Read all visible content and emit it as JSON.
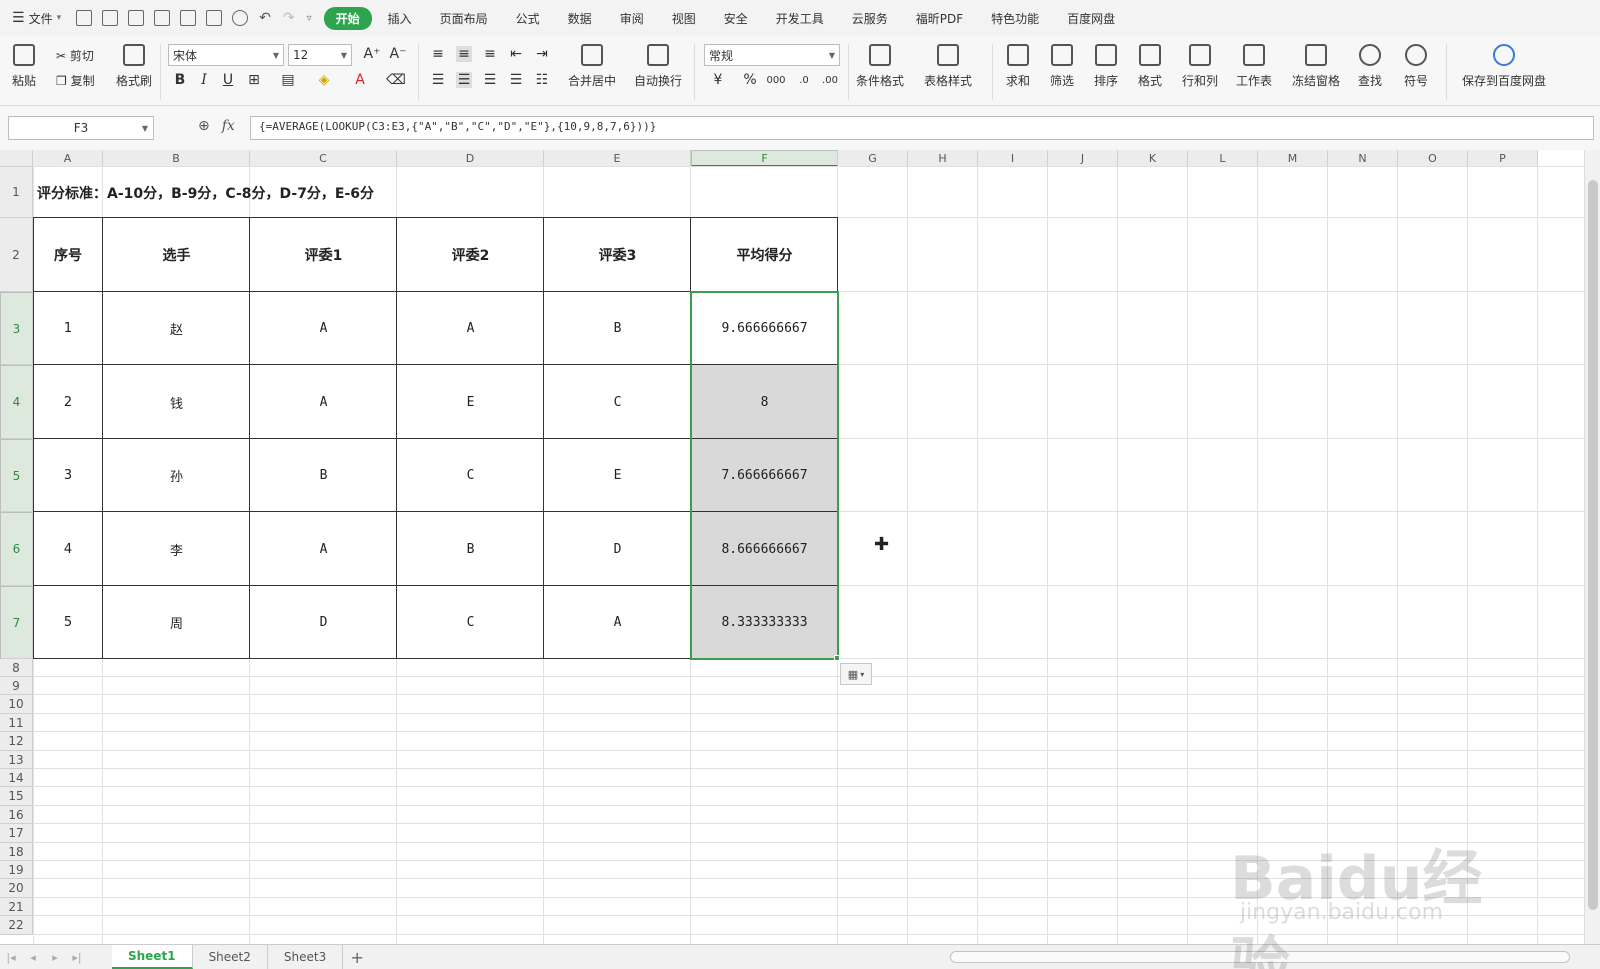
{
  "menubar": {
    "file_label": "文件",
    "tabs": [
      "开始",
      "插入",
      "页面布局",
      "公式",
      "数据",
      "审阅",
      "视图",
      "安全",
      "开发工具",
      "云服务",
      "福昕PDF",
      "特色功能",
      "百度网盘"
    ]
  },
  "ribbon": {
    "paste": "粘贴",
    "cut": "剪切",
    "copy": "复制",
    "format_painter": "格式刷",
    "font_name": "宋体",
    "font_size": "12",
    "merge_center": "合并居中",
    "wrap_text": "自动换行",
    "number_format": "常规",
    "conditional_format": "条件格式",
    "table_style": "表格样式",
    "sum": "求和",
    "filter": "筛选",
    "sort": "排序",
    "format": "格式",
    "row_col": "行和列",
    "worksheet": "工作表",
    "freeze": "冻结窗格",
    "find": "查找",
    "symbol": "符号",
    "save_baidu": "保存到百度网盘"
  },
  "formula_bar": {
    "name_box": "F3",
    "fx": "fx",
    "formula": "{=AVERAGE(LOOKUP(C3:E3,{\"A\",\"B\",\"C\",\"D\",\"E\"},{10,9,8,7,6}))}"
  },
  "sheet": {
    "columns": [
      "A",
      "B",
      "C",
      "D",
      "E",
      "F",
      "G",
      "H",
      "I",
      "J",
      "K",
      "L",
      "M",
      "N",
      "O",
      "P"
    ],
    "rows": [
      "1",
      "2",
      "3",
      "4",
      "5",
      "6",
      "7",
      "8",
      "9",
      "10",
      "11",
      "12",
      "13",
      "14",
      "15",
      "16",
      "17",
      "18",
      "19",
      "20",
      "21",
      "22"
    ],
    "title": "评分标准：A-10分，B-9分，C-8分，D-7分，E-6分",
    "headers": [
      "序号",
      "选手",
      "评委1",
      "评委2",
      "评委3",
      "平均得分"
    ],
    "data": [
      [
        "1",
        "赵",
        "A",
        "A",
        "B",
        "9.666666667"
      ],
      [
        "2",
        "钱",
        "A",
        "E",
        "C",
        "8"
      ],
      [
        "3",
        "孙",
        "B",
        "C",
        "E",
        "7.666666667"
      ],
      [
        "4",
        "李",
        "A",
        "B",
        "D",
        "8.666666667"
      ],
      [
        "5",
        "周",
        "D",
        "C",
        "A",
        "8.333333333"
      ]
    ]
  },
  "sheets": [
    "Sheet1",
    "Sheet2",
    "Sheet3"
  ],
  "watermark": {
    "brand": "Baidu经验",
    "url": "jingyan.baidu.com"
  }
}
